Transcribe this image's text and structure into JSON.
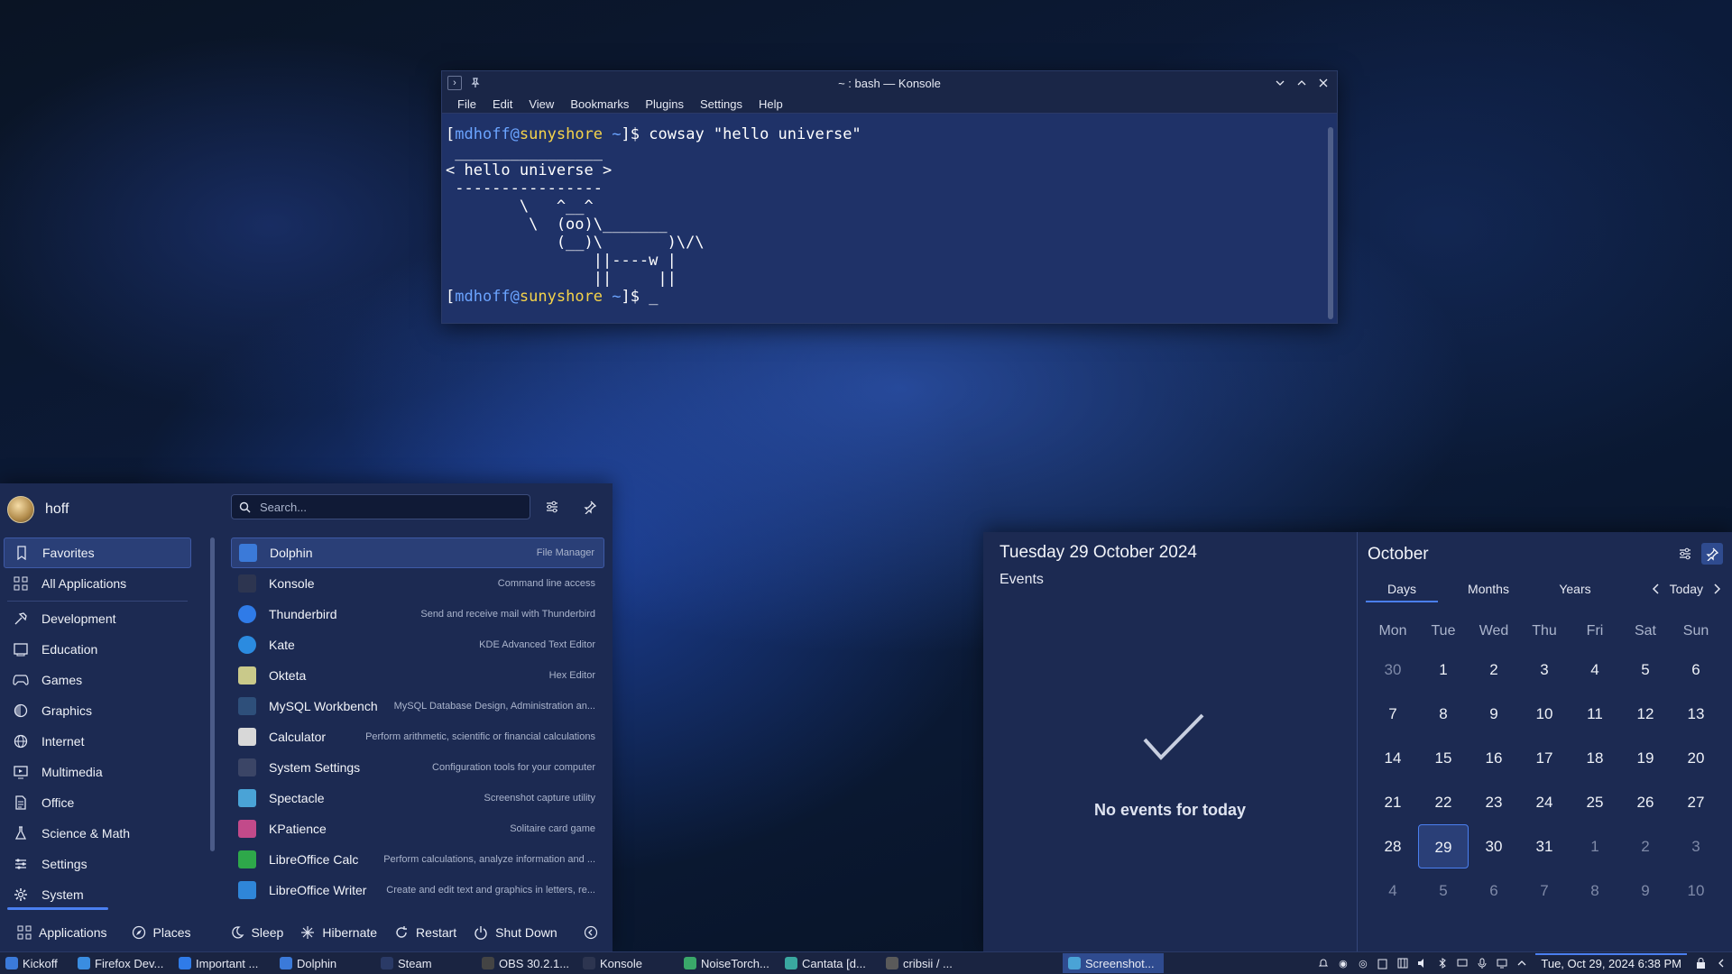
{
  "konsole": {
    "title": "~ : bash — Konsole",
    "menu": [
      "File",
      "Edit",
      "View",
      "Bookmarks",
      "Plugins",
      "Settings",
      "Help"
    ],
    "prompt_user": "mdhoff",
    "prompt_at": "@",
    "prompt_host": "sunyshore",
    "prompt_dir": "~",
    "prompt_open": "[",
    "prompt_close": "]$ ",
    "command": "cowsay \"hello universe\"",
    "output": " ________________\n< hello universe >\n ----------------\n        \\   ^__^\n         \\  (oo)\\_______\n            (__)\\       )\\/\\\n                ||----w |\n                ||     ||",
    "cursor": "_"
  },
  "kickoff": {
    "username": "hoff",
    "search_placeholder": "Search...",
    "categories": [
      {
        "label": "Favorites",
        "icon": "bookmark-icon"
      },
      {
        "label": "All Applications",
        "icon": "grid-icon"
      },
      {
        "label": "Development",
        "icon": "hammer-icon"
      },
      {
        "label": "Education",
        "icon": "monitor-icon"
      },
      {
        "label": "Games",
        "icon": "gamepad-icon"
      },
      {
        "label": "Graphics",
        "icon": "palette-icon"
      },
      {
        "label": "Internet",
        "icon": "globe-icon"
      },
      {
        "label": "Multimedia",
        "icon": "media-icon"
      },
      {
        "label": "Office",
        "icon": "document-icon"
      },
      {
        "label": "Science & Math",
        "icon": "flask-icon"
      },
      {
        "label": "Settings",
        "icon": "sliders-icon"
      },
      {
        "label": "System",
        "icon": "gear-icon"
      }
    ],
    "apps": [
      {
        "name": "Dolphin",
        "desc": "File Manager",
        "color": "#3b7ad9"
      },
      {
        "name": "Konsole",
        "desc": "Command line access",
        "color": "#2d3550"
      },
      {
        "name": "Thunderbird",
        "desc": "Send and receive mail with Thunderbird",
        "color": "#2f7be8"
      },
      {
        "name": "Kate",
        "desc": "KDE Advanced Text Editor",
        "color": "#2b8be0"
      },
      {
        "name": "Okteta",
        "desc": "Hex Editor",
        "color": "#c9c98a"
      },
      {
        "name": "MySQL Workbench",
        "desc": "MySQL Database Design, Administration an...",
        "color": "#2e4f7a"
      },
      {
        "name": "Calculator",
        "desc": "Perform arithmetic, scientific or financial calculations",
        "color": "#d8d8d8"
      },
      {
        "name": "System Settings",
        "desc": "Configuration tools for your computer",
        "color": "#3b4566"
      },
      {
        "name": "Spectacle",
        "desc": "Screenshot capture utility",
        "color": "#4aa3d6"
      },
      {
        "name": "KPatience",
        "desc": "Solitaire card game",
        "color": "#c24a8a"
      },
      {
        "name": "LibreOffice Calc",
        "desc": "Perform calculations, analyze information and ...",
        "color": "#2ea84a"
      },
      {
        "name": "LibreOffice Writer",
        "desc": "Create and edit text and graphics in letters, re...",
        "color": "#2f86d9"
      }
    ],
    "footer": {
      "applications": "Applications",
      "places": "Places",
      "sleep": "Sleep",
      "hibernate": "Hibernate",
      "restart": "Restart",
      "shutdown": "Shut Down"
    }
  },
  "calendar": {
    "full_date": "Tuesday 29 October 2024",
    "events_label": "Events",
    "no_events": "No events for today",
    "month": "October",
    "tabs": [
      "Days",
      "Months",
      "Years"
    ],
    "today_label": "Today",
    "weekdays": [
      "Mon",
      "Tue",
      "Wed",
      "Thu",
      "Fri",
      "Sat",
      "Sun"
    ],
    "days": [
      [
        "30",
        "1",
        "2",
        "3",
        "4",
        "5",
        "6"
      ],
      [
        "7",
        "8",
        "9",
        "10",
        "11",
        "12",
        "13"
      ],
      [
        "14",
        "15",
        "16",
        "17",
        "18",
        "19",
        "20"
      ],
      [
        "21",
        "22",
        "23",
        "24",
        "25",
        "26",
        "27"
      ],
      [
        "28",
        "29",
        "30",
        "31",
        "1",
        "2",
        "3"
      ],
      [
        "4",
        "5",
        "6",
        "7",
        "8",
        "9",
        "10"
      ]
    ],
    "selected_day": "29"
  },
  "taskbar": {
    "items": [
      {
        "label": "Kickoff",
        "color": "#3b7ad9"
      },
      {
        "label": "Firefox Dev...",
        "color": "#3a8de0"
      },
      {
        "label": "Important ...",
        "color": "#2f7be8"
      },
      {
        "label": "Dolphin",
        "color": "#3b7ad9"
      },
      {
        "label": "Steam",
        "color": "#2a3a66"
      },
      {
        "label": "OBS 30.2.1...",
        "color": "#444444"
      },
      {
        "label": "Konsole",
        "color": "#2d3550"
      },
      {
        "label": "NoiseTorch...",
        "color": "#3aa86a"
      },
      {
        "label": "Cantata [d...",
        "color": "#3aa8a0"
      },
      {
        "label": "cribsii / ...",
        "color": "#5a5a5a"
      },
      {
        "label": "Screenshot...",
        "color": "#4aa3d6"
      }
    ],
    "clock": "Tue, Oct 29, 2024 6:38 PM"
  }
}
